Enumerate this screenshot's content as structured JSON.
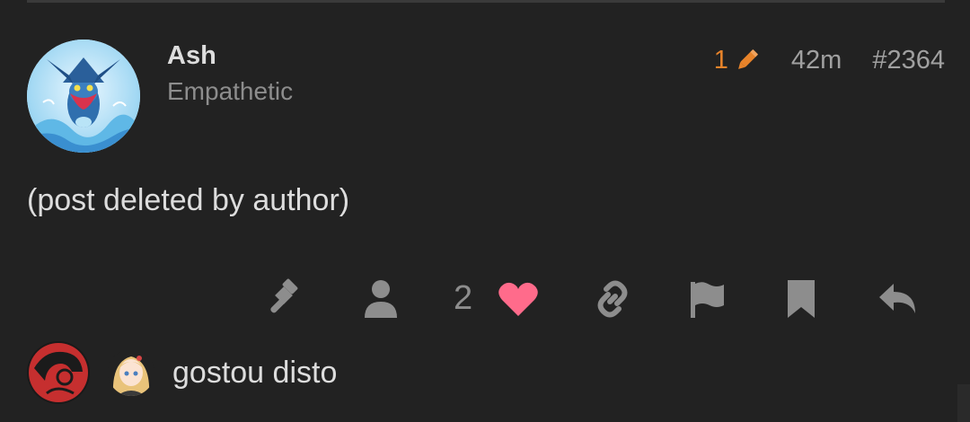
{
  "post": {
    "username": "Ash",
    "user_title": "Empathetic",
    "edit_count": "1",
    "age": "42m",
    "post_number": "#2364",
    "body": "(post deleted by author)"
  },
  "actions": {
    "like_count": "2",
    "icons": [
      "gavel-icon",
      "user-icon",
      "heart-icon",
      "link-icon",
      "flag-icon",
      "bookmark-icon",
      "reply-icon"
    ],
    "heart_color": "#ff6b8b",
    "icon_color": "#8d8d8d"
  },
  "likers": {
    "text": "gostou disto"
  },
  "colors": {
    "background": "#222222",
    "accent_edit": "#e7832a",
    "text": "#dddddd",
    "muted": "#8d8d8d"
  }
}
